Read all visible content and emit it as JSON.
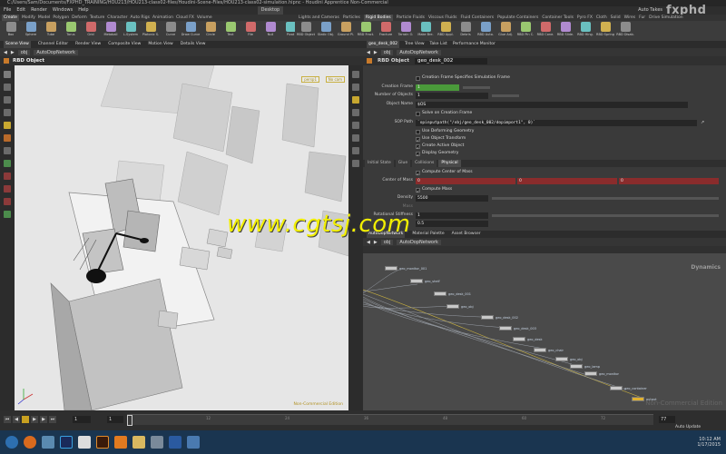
{
  "window": {
    "title": "C:/Users/Sam/Documents/FXPHD_TRAINING/HOU213/HOU213-class02-files/Houdini-Scene-Files/HOU213-class02-simulation.hipnc - Houdini Apprentice Non-Commercial",
    "auto_takes": "Auto Takes",
    "logo": "fxphd"
  },
  "menu": [
    "File",
    "Edit",
    "Render",
    "Windows",
    "Help"
  ],
  "desktop_label": "Desktop",
  "shelf_left": {
    "tabs": [
      "Create",
      "Modify",
      "Model",
      "Polygon",
      "Deform",
      "Texture",
      "Character",
      "Auto Rigs",
      "Animation",
      "Cloud FX",
      "Volume"
    ],
    "tools": [
      "Box",
      "Sphere",
      "Tube",
      "Torus",
      "Grid",
      "Metaball",
      "L-System",
      "Platonic S.",
      "Curve",
      "Draw Curve",
      "Circle",
      "Text",
      "File",
      "Null",
      "Pivot"
    ]
  },
  "shelf_right": {
    "tabs": [
      "Lights and Cameras",
      "Particles",
      "Rigid Bodies",
      "Particle Fluids",
      "Viscous Fluids",
      "Fluid Containers",
      "Populate Containers",
      "Container Tools",
      "Pyro FX",
      "Cloth",
      "Solid",
      "Wires",
      "Fur",
      "Drive Simulation"
    ],
    "active_tab": "Rigid Bodies",
    "tools": [
      "RBD Object",
      "Static Obj.",
      "Ground Pl.",
      "RBD Fract.",
      "Fracture",
      "Terrain O.",
      "Make Bre.",
      "RBD Appl.",
      "Debris",
      "RBD Auto.",
      "Glue Adj.",
      "RBD Pin C.",
      "RBD Cone.",
      "RBD Slide.",
      "RBD Hing.",
      "RBD Spring",
      "RBD Disab."
    ]
  },
  "viewer": {
    "tabs": [
      "Scene View",
      "Channel Editor",
      "Render View",
      "Composite View",
      "Motion View",
      "Details View"
    ],
    "path": [
      "obj",
      "AutoDopNetwork"
    ],
    "header": "RBD Object",
    "camera_label": "persp1",
    "cam_label": "No cam",
    "edition": "Non-Commercial Edition"
  },
  "params": {
    "tabs": [
      "geo_desk_002",
      "Tree View",
      "Take List",
      "Performance Monitor"
    ],
    "path": [
      "obj",
      "AutoDopNetwork"
    ],
    "node_type": "RBD Object",
    "node_name": "geo_desk_002",
    "creation_frame_specifies": "Creation Frame Specifies Simulation Frame",
    "creation_frame_label": "Creation Frame",
    "creation_frame": "1",
    "num_objects_label": "Number of Objects",
    "num_objects": "1",
    "object_name_label": "Object Name",
    "object_name": "$OS",
    "solve_on_creation": "Solve on Creation Frame",
    "sop_path_label": "SOP Path",
    "sop_path": "`opinputpath(\"/obj/geo_desk_002/dopimport1\", 0)`",
    "use_deforming": "Use Deforming Geometry",
    "use_transform": "Use Object Transform",
    "create_active": "Create Active Object",
    "display_geometry": "Display Geometry",
    "subtabs": [
      "Initial State",
      "Glue",
      "Collisions",
      "Physical"
    ],
    "compute_com": "Compute Center of Mass",
    "com_label": "Center of Mass",
    "com": [
      "0",
      "0",
      "0"
    ],
    "compute_mass": "Compute Mass",
    "density_label": "Density",
    "density": "5500",
    "mass_label": "Mass",
    "rot_stiff_label": "Rotational Stiffness",
    "rot_stiff": "1",
    "extra_value": "0.5"
  },
  "network": {
    "tabs": [
      "AutoDopNetwork",
      "Material Palette",
      "Asset Browser"
    ],
    "path": [
      "obj",
      "AutoDopNetwork"
    ],
    "context": "Dynamics",
    "edition": "Non-Commercial Edition",
    "nodes": [
      {
        "label": "geo_monitor_001"
      },
      {
        "label": "geo_shelf"
      },
      {
        "label": "geo_desk_001"
      },
      {
        "label": "geo_obj"
      },
      {
        "label": "geo_desk_002"
      },
      {
        "label": "geo_desk_003"
      },
      {
        "label": "geo_desk"
      },
      {
        "label": "geo_chair"
      },
      {
        "label": "geo_obj"
      },
      {
        "label": "geo_lamp"
      },
      {
        "label": "geo_monitor"
      },
      {
        "label": "geo_container"
      },
      {
        "label": "output"
      }
    ]
  },
  "timeline": {
    "current_frame": "1",
    "start_frame": "1",
    "end_frame": "77",
    "ticks": [
      "12",
      "24",
      "36",
      "48",
      "60",
      "72"
    ],
    "auto_update": "Auto Update"
  },
  "taskbar": {
    "time": "10:12 AM",
    "date": "1/17/2015"
  },
  "watermark": "www.cgtsj.com"
}
